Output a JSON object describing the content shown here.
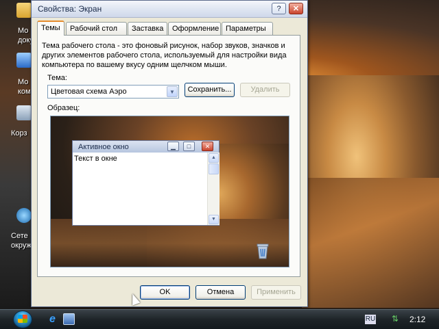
{
  "desktop": {
    "icons": [
      {
        "label": "Мо докум",
        "icon": "folder-icon"
      },
      {
        "label": "Мо компь",
        "icon": "computer-icon"
      },
      {
        "label": "Корз",
        "icon": "recycle-bin-icon"
      },
      {
        "label": "Сете окруж",
        "icon": "network-icon"
      }
    ]
  },
  "window": {
    "title": "Свойства: Экран",
    "help_button": "?",
    "close_button": "✕",
    "tabs": [
      "Темы",
      "Рабочий стол",
      "Заставка",
      "Оформление",
      "Параметры"
    ],
    "active_tab": "Темы",
    "description": "Тема рабочего стола - это фоновый рисунок, набор звуков, значков и других элементов рабочего стола, используемый для настройки вида компьютера по вашему вкусу одним щелчком мыши.",
    "theme_label": "Тема:",
    "theme_value": "Цветовая схема Аэро",
    "save_button": "Сохранить...",
    "delete_button": "Удалить",
    "sample_label": "Образец:",
    "preview": {
      "window_title": "Активное окно",
      "window_text": "Текст в окне"
    },
    "ok_button": "OK",
    "cancel_button": "Отмена",
    "apply_button": "Применить"
  },
  "taskbar": {
    "language": "RU",
    "clock": "2:12"
  }
}
